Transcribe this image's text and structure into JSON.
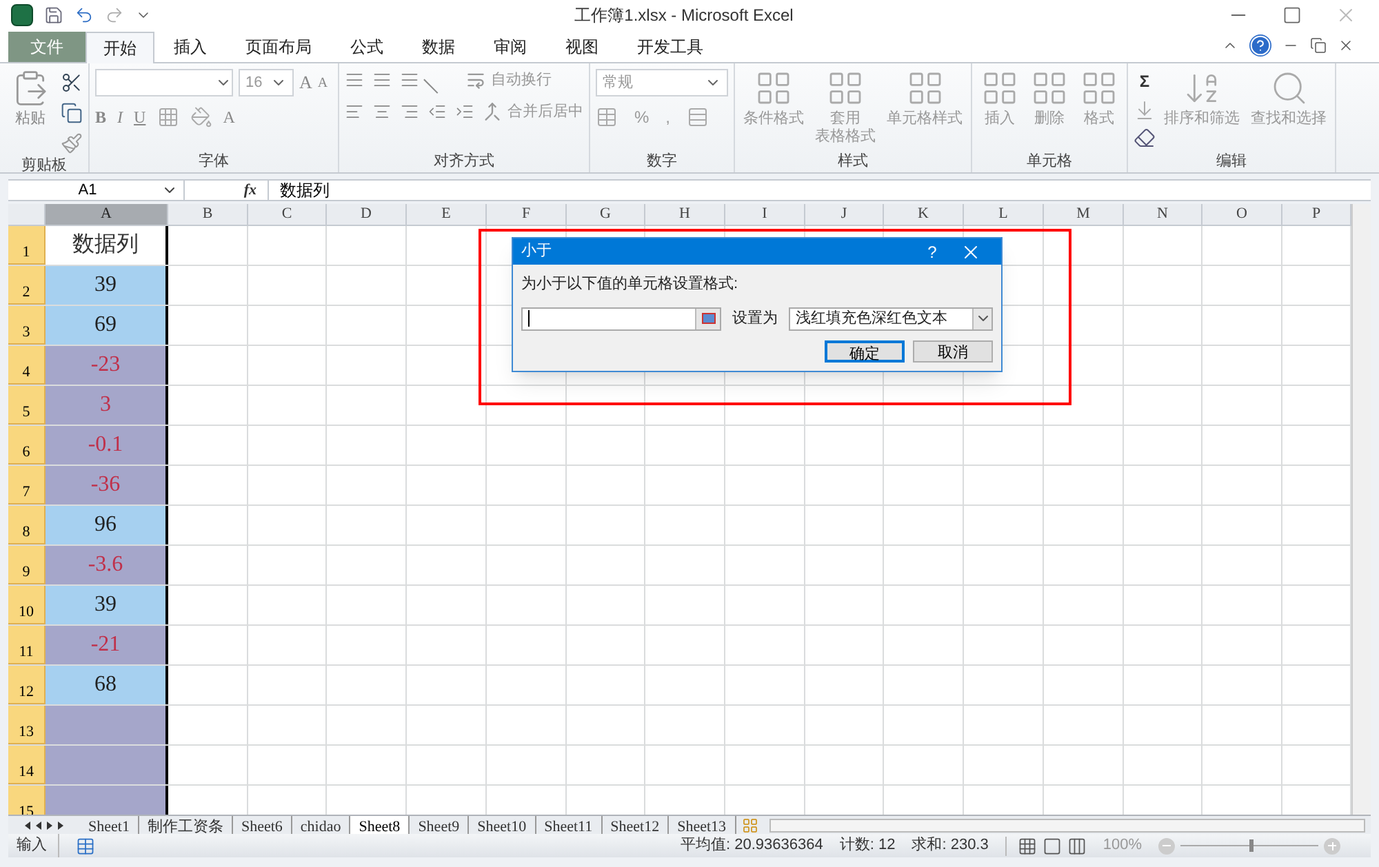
{
  "window": {
    "title": "工作簿1.xlsx - Microsoft Excel"
  },
  "ribbon_tabs": [
    {
      "label": "文件",
      "kind": "file",
      "selected": false
    },
    {
      "label": "开始",
      "kind": "tab",
      "selected": true
    },
    {
      "label": "插入",
      "kind": "tab",
      "selected": false
    },
    {
      "label": "页面布局",
      "kind": "tab",
      "selected": false
    },
    {
      "label": "公式",
      "kind": "tab",
      "selected": false
    },
    {
      "label": "数据",
      "kind": "tab",
      "selected": false
    },
    {
      "label": "审阅",
      "kind": "tab",
      "selected": false
    },
    {
      "label": "视图",
      "kind": "tab",
      "selected": false
    },
    {
      "label": "开发工具",
      "kind": "tab",
      "selected": false
    }
  ],
  "ribbon_groups": [
    {
      "kind": "clipboard",
      "title": "剪贴板",
      "paste_label": "粘贴"
    },
    {
      "kind": "font",
      "title": "字体",
      "font_size": "16",
      "bold": "B",
      "italic": "I",
      "underline": "U",
      "grow": "A",
      "shrink": "A",
      "font_color": "A"
    },
    {
      "kind": "alignment",
      "title": "对齐方式",
      "wrap": "自动换行",
      "merge": "合并后居中"
    },
    {
      "kind": "number",
      "title": "数字",
      "format": "常规",
      "percent": "%",
      "comma": ","
    },
    {
      "kind": "buttons",
      "title": "样式",
      "buttons": [
        {
          "lines": [
            "条件格式"
          ]
        },
        {
          "lines": [
            "套用",
            "表格格式"
          ]
        },
        {
          "lines": [
            "单元格样式"
          ]
        }
      ]
    },
    {
      "kind": "buttons",
      "title": "单元格",
      "buttons": [
        {
          "lines": [
            "插入"
          ]
        },
        {
          "lines": [
            "删除"
          ]
        },
        {
          "lines": [
            "格式"
          ]
        }
      ]
    },
    {
      "kind": "editing",
      "title": "编辑",
      "sum": "Σ",
      "buttons": [
        "排序和筛选",
        "查找和选择"
      ]
    }
  ],
  "formula_bar": {
    "name_box": "A1",
    "fx_label": "fx",
    "formula": "数据列"
  },
  "columns": [
    {
      "label": "A",
      "selected": true
    },
    {
      "label": "B",
      "selected": false
    },
    {
      "label": "C",
      "selected": false
    },
    {
      "label": "D",
      "selected": false
    },
    {
      "label": "E",
      "selected": false
    },
    {
      "label": "F",
      "selected": false
    },
    {
      "label": "G",
      "selected": false
    },
    {
      "label": "H",
      "selected": false
    },
    {
      "label": "I",
      "selected": false
    },
    {
      "label": "J",
      "selected": false
    },
    {
      "label": "K",
      "selected": false
    },
    {
      "label": "L",
      "selected": false
    },
    {
      "label": "M",
      "selected": false
    },
    {
      "label": "N",
      "selected": false
    },
    {
      "label": "O",
      "selected": false
    },
    {
      "label": "P",
      "selected": false
    }
  ],
  "rows": [
    {
      "header": "1",
      "value": "数据列",
      "kind": "active",
      "highlighted": false
    },
    {
      "header": "2",
      "value": "39",
      "kind": "cell",
      "highlighted": false
    },
    {
      "header": "3",
      "value": "69",
      "kind": "cell",
      "highlighted": false
    },
    {
      "header": "4",
      "value": "-23",
      "kind": "cell",
      "highlighted": true
    },
    {
      "header": "5",
      "value": "3",
      "kind": "cell",
      "highlighted": true
    },
    {
      "header": "6",
      "value": "-0.1",
      "kind": "cell",
      "highlighted": true
    },
    {
      "header": "7",
      "value": "-36",
      "kind": "cell",
      "highlighted": true
    },
    {
      "header": "8",
      "value": "96",
      "kind": "cell",
      "highlighted": false
    },
    {
      "header": "9",
      "value": "-3.6",
      "kind": "cell",
      "highlighted": true
    },
    {
      "header": "10",
      "value": "39",
      "kind": "cell",
      "highlighted": false
    },
    {
      "header": "11",
      "value": "-21",
      "kind": "cell",
      "highlighted": true
    },
    {
      "header": "12",
      "value": "68",
      "kind": "cell",
      "highlighted": false
    },
    {
      "header": "13",
      "kind": "cell",
      "highlighted": true
    },
    {
      "header": "14",
      "kind": "cell",
      "highlighted": true
    },
    {
      "header": "15",
      "kind": "cell",
      "highlighted": true
    }
  ],
  "dialog": {
    "title": "小于",
    "help": "?",
    "prompt": "为小于以下值的单元格设置格式:",
    "format_label": "设置为",
    "format_value": "浅红填充色深红色文本",
    "buttons": [
      {
        "label": "确定",
        "default": true
      },
      {
        "label": "取消",
        "default": false
      }
    ]
  },
  "sheet_tabs": [
    {
      "label": "Sheet1",
      "selected": false
    },
    {
      "label": "制作工资条",
      "selected": false
    },
    {
      "label": "Sheet6",
      "selected": false
    },
    {
      "label": "chidao",
      "selected": false
    },
    {
      "label": "Sheet8",
      "selected": true
    },
    {
      "label": "Sheet9",
      "selected": false
    },
    {
      "label": "Sheet10",
      "selected": false
    },
    {
      "label": "Sheet11",
      "selected": false
    },
    {
      "label": "Sheet12",
      "selected": false
    },
    {
      "label": "Sheet13",
      "selected": false
    }
  ],
  "status_bar": {
    "mode": "输入",
    "average": "平均值: 20.93636364",
    "count": "计数: 12",
    "sum": "求和: 230.3",
    "zoom": "100%",
    "zoom_level": {
      "level": 0.5
    }
  }
}
